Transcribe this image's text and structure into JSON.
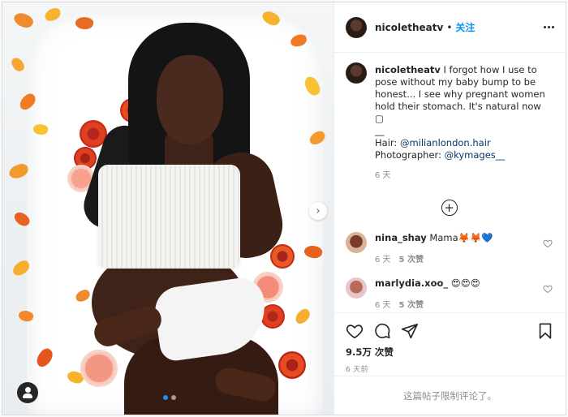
{
  "post": {
    "username": "nicoletheatv",
    "separator": "•",
    "follow_label": "关注",
    "caption_username": "nicoletheatv",
    "caption_text": "I forgot how I use to pose without my baby bump to be honest... I see why pregnant women hold their stomach. It's natural now",
    "caption_emoji": "▢",
    "caption_dash": "__",
    "hair_label": "Hair:",
    "hair_handle": "@milianlondon.hair",
    "photographer_label": "Photographer:",
    "photographer_handle": "@kymages__",
    "caption_time": "6 天",
    "load_more": "+"
  },
  "comments": [
    {
      "username": "nina_shay",
      "text": "Mama🦊🦊💙",
      "time": "6 天",
      "likes": "5 次赞"
    },
    {
      "username": "marlydia.xoo_",
      "text": "😍😍😍",
      "time": "6 天",
      "likes": "5 次赞"
    }
  ],
  "actions": {
    "likes_count": "9.5万 次赞",
    "date": "6 天前",
    "comments_limited": "这篇帖子限制评论了。"
  },
  "carousel": {
    "arrow": "›",
    "slides": 2,
    "active": 1
  },
  "icons": [
    "more-icon",
    "heart-icon",
    "comment-icon",
    "share-icon",
    "bookmark-icon",
    "user-tag-icon",
    "next-arrow-icon",
    "load-more-icon"
  ],
  "colors": {
    "link": "#00376b",
    "follow": "#0095f6",
    "dot_active": "#1a91f0",
    "muted": "#8e8e8e"
  }
}
